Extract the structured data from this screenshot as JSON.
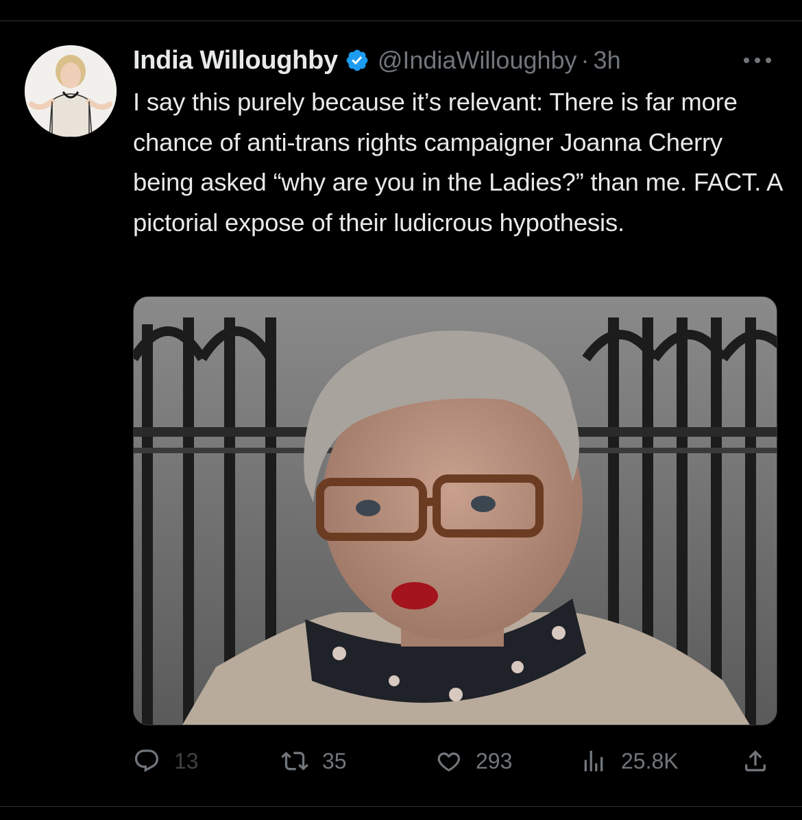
{
  "tweet": {
    "author": {
      "display_name": "India Willoughby",
      "handle": "@IndiaWilloughby",
      "verified": true
    },
    "separator": "·",
    "time": "3h",
    "text": "I say this purely because it’s relevant: There is far more chance of anti-trans rights campaigner Joanna Cherry being asked “why are you in the Ladies?” than me. FACT. A pictorial expose of their ludicrous hypothesis.",
    "media": {
      "type": "photo"
    },
    "metrics": {
      "replies": "13",
      "retweets": "35",
      "likes": "293",
      "views": "25.8K"
    }
  },
  "icons": {
    "verified": "verified-badge-icon",
    "more": "more-options-icon",
    "reply": "reply-icon",
    "retweet": "retweet-icon",
    "like": "heart-icon",
    "views": "views-icon",
    "share": "share-icon"
  },
  "colors": {
    "background": "#000000",
    "text_primary": "#e7e9ea",
    "text_secondary": "#71767b",
    "verified": "#1d9bf0",
    "divider": "#2f3336"
  }
}
